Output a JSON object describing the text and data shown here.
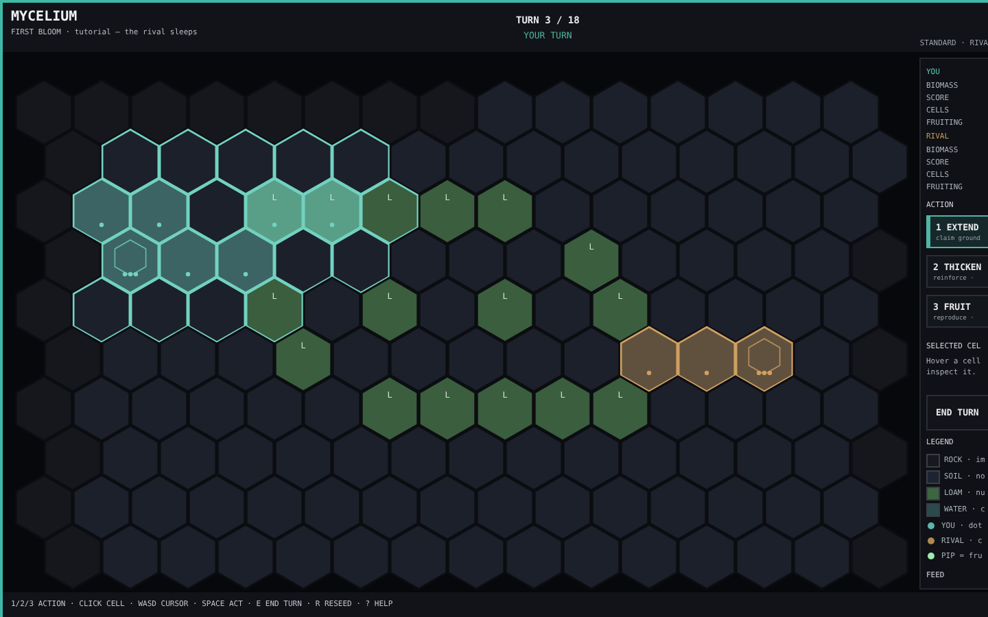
{
  "header": {
    "title": "MYCELIUM",
    "subtitle": "FIRST BLOOM · tutorial — the rival sleeps",
    "turn": "TURN 3 / 18",
    "turn_state": "YOUR TURN",
    "mode": "STANDARD · RIVA"
  },
  "map": {
    "rows": [
      {
        "cells": [
          {
            "kind": "rock"
          },
          {
            "kind": "rock"
          },
          {
            "kind": "rock"
          },
          {
            "kind": "rock"
          },
          {
            "kind": "rock"
          },
          {
            "kind": "rock"
          },
          {
            "kind": "rock"
          },
          {
            "kind": "rock"
          },
          {
            "kind": "soil"
          },
          {
            "kind": "soil"
          },
          {
            "kind": "soil"
          },
          {
            "kind": "soil"
          },
          {
            "kind": "soil"
          },
          {
            "kind": "soil"
          },
          {
            "kind": "soil"
          }
        ]
      },
      {
        "cells": [
          {
            "kind": "rock"
          },
          {
            "kind": "soil",
            "color": "#72d2c0",
            "biomass": false,
            "fruiting": false
          },
          {
            "kind": "soil",
            "color": "#72d2c0",
            "biomass": false,
            "fruiting": false
          },
          {
            "kind": "soil",
            "color": "#72d2c0",
            "biomass": false,
            "fruiting": false
          },
          {
            "kind": "soil",
            "color": "#72d2c0",
            "biomass": false,
            "fruiting": false
          },
          {
            "kind": "soil",
            "color": "#72d2c0",
            "biomass": false,
            "fruiting": false
          },
          {
            "kind": "soil"
          },
          {
            "kind": "soil"
          },
          {
            "kind": "soil"
          },
          {
            "kind": "soil"
          },
          {
            "kind": "soil"
          },
          {
            "kind": "soil"
          },
          {
            "kind": "soil"
          },
          {
            "kind": "soil"
          },
          {
            "kind": "soil"
          }
        ]
      },
      {
        "cells": [
          {
            "kind": "rock"
          },
          {
            "kind": "soil",
            "color": "#72d2c0",
            "biomass": true,
            "fruiting": false
          },
          {
            "kind": "soil",
            "color": "#72d2c0",
            "biomass": true,
            "fruiting": false
          },
          {
            "kind": "soil",
            "color": "#72d2c0",
            "biomass": false,
            "fruiting": false
          },
          {
            "kind": "loam",
            "label": "L",
            "color": "#72d2c0",
            "biomass": true,
            "fruiting": false
          },
          {
            "kind": "loam",
            "label": "L",
            "color": "#72d2c0",
            "biomass": true,
            "fruiting": false
          },
          {
            "kind": "loam",
            "label": "L",
            "color": "#72d2c0",
            "biomass": false,
            "fruiting": false
          },
          {
            "kind": "loam",
            "label": "L"
          },
          {
            "kind": "loam",
            "label": "L"
          },
          {
            "kind": "soil"
          },
          {
            "kind": "soil"
          },
          {
            "kind": "soil"
          },
          {
            "kind": "soil"
          },
          {
            "kind": "soil"
          },
          {
            "kind": "soil"
          }
        ]
      },
      {
        "cells": [
          {
            "kind": "rock"
          },
          {
            "kind": "soil",
            "color": "#72d2c0",
            "biomass": true,
            "fruiting": true
          },
          {
            "kind": "soil",
            "color": "#72d2c0",
            "biomass": true,
            "fruiting": false
          },
          {
            "kind": "soil",
            "color": "#72d2c0",
            "biomass": true,
            "fruiting": false
          },
          {
            "kind": "soil",
            "color": "#72d2c0",
            "biomass": false,
            "fruiting": false
          },
          {
            "kind": "soil",
            "color": "#72d2c0",
            "biomass": false,
            "fruiting": false
          },
          {
            "kind": "soil"
          },
          {
            "kind": "soil"
          },
          {
            "kind": "soil"
          },
          {
            "kind": "loam",
            "label": "L"
          },
          {
            "kind": "soil"
          },
          {
            "kind": "soil"
          },
          {
            "kind": "soil"
          },
          {
            "kind": "soil"
          },
          {
            "kind": "rock"
          }
        ]
      },
      {
        "cells": [
          {
            "kind": "rock"
          },
          {
            "kind": "soil",
            "color": "#72d2c0",
            "biomass": false,
            "fruiting": false
          },
          {
            "kind": "soil",
            "color": "#72d2c0",
            "biomass": false,
            "fruiting": false
          },
          {
            "kind": "soil",
            "color": "#72d2c0",
            "biomass": false,
            "fruiting": false
          },
          {
            "kind": "loam",
            "label": "L",
            "color": "#72d2c0",
            "biomass": false,
            "fruiting": false
          },
          {
            "kind": "soil"
          },
          {
            "kind": "loam",
            "label": "L"
          },
          {
            "kind": "soil"
          },
          {
            "kind": "loam",
            "label": "L"
          },
          {
            "kind": "soil"
          },
          {
            "kind": "loam",
            "label": "L"
          },
          {
            "kind": "soil"
          },
          {
            "kind": "soil"
          },
          {
            "kind": "soil"
          },
          {
            "kind": "soil"
          }
        ]
      },
      {
        "cells": [
          {
            "kind": "rock"
          },
          {
            "kind": "soil"
          },
          {
            "kind": "soil"
          },
          {
            "kind": "soil"
          },
          {
            "kind": "loam",
            "label": "L"
          },
          {
            "kind": "soil"
          },
          {
            "kind": "soil"
          },
          {
            "kind": "soil"
          },
          {
            "kind": "soil"
          },
          {
            "kind": "soil"
          },
          {
            "kind": "soil",
            "color": "#d0a060",
            "biomass": true,
            "fruiting": false
          },
          {
            "kind": "soil",
            "color": "#d0a060",
            "biomass": true,
            "fruiting": false
          },
          {
            "kind": "soil",
            "color": "#d0a060",
            "biomass": true,
            "fruiting": true
          },
          {
            "kind": "soil"
          },
          {
            "kind": "rock"
          }
        ]
      },
      {
        "cells": [
          {
            "kind": "rock"
          },
          {
            "kind": "soil"
          },
          {
            "kind": "soil"
          },
          {
            "kind": "soil"
          },
          {
            "kind": "soil"
          },
          {
            "kind": "soil"
          },
          {
            "kind": "loam",
            "label": "L"
          },
          {
            "kind": "loam",
            "label": "L"
          },
          {
            "kind": "loam",
            "label": "L"
          },
          {
            "kind": "loam",
            "label": "L"
          },
          {
            "kind": "loam",
            "label": "L"
          },
          {
            "kind": "soil"
          },
          {
            "kind": "soil"
          },
          {
            "kind": "soil"
          },
          {
            "kind": "soil"
          }
        ]
      },
      {
        "cells": [
          {
            "kind": "rock"
          },
          {
            "kind": "soil"
          },
          {
            "kind": "soil"
          },
          {
            "kind": "soil"
          },
          {
            "kind": "soil"
          },
          {
            "kind": "soil"
          },
          {
            "kind": "soil"
          },
          {
            "kind": "soil"
          },
          {
            "kind": "soil"
          },
          {
            "kind": "soil"
          },
          {
            "kind": "soil"
          },
          {
            "kind": "soil"
          },
          {
            "kind": "soil"
          },
          {
            "kind": "soil"
          },
          {
            "kind": "rock"
          }
        ]
      },
      {
        "cells": [
          {
            "kind": "rock"
          },
          {
            "kind": "soil"
          },
          {
            "kind": "soil"
          },
          {
            "kind": "soil"
          },
          {
            "kind": "soil"
          },
          {
            "kind": "soil"
          },
          {
            "kind": "soil"
          },
          {
            "kind": "soil"
          },
          {
            "kind": "soil"
          },
          {
            "kind": "soil"
          },
          {
            "kind": "soil"
          },
          {
            "kind": "soil"
          },
          {
            "kind": "soil"
          },
          {
            "kind": "soil"
          },
          {
            "kind": "soil"
          }
        ]
      },
      {
        "cells": [
          {
            "kind": "rock"
          },
          {
            "kind": "soil"
          },
          {
            "kind": "soil"
          },
          {
            "kind": "soil"
          },
          {
            "kind": "soil"
          },
          {
            "kind": "soil"
          },
          {
            "kind": "soil"
          },
          {
            "kind": "soil"
          },
          {
            "kind": "soil"
          },
          {
            "kind": "soil"
          },
          {
            "kind": "soil"
          },
          {
            "kind": "soil"
          },
          {
            "kind": "soil"
          },
          {
            "kind": "soil"
          },
          {
            "kind": "rock"
          }
        ]
      }
    ]
  },
  "sidebar": {
    "players": [
      {
        "name": "YOU",
        "color": "#5fc7b4",
        "stats": [
          "BIOMASS",
          "SCORE",
          "CELLS",
          "FRUITING"
        ]
      },
      {
        "name": "RIVAL",
        "color": "#c99a5a",
        "stats": [
          "BIOMASS",
          "SCORE",
          "CELLS",
          "FRUITING"
        ]
      }
    ],
    "action_heading": "ACTION",
    "actions": [
      {
        "title": "1 EXTEND",
        "hint": "claim ground",
        "selected": true
      },
      {
        "title": "2 THICKEN",
        "hint": "reinforce ·",
        "selected": false
      },
      {
        "title": "3 FRUIT",
        "hint": "reproduce ·",
        "selected": false
      }
    ],
    "selected_heading": "SELECTED CEL",
    "selected_text": "Hover a cell inspect it.",
    "end_turn": "END TURN",
    "legend_heading": "LEGEND",
    "legend": [
      {
        "kind": "swatch",
        "color": "#17191e",
        "label": "ROCK · im"
      },
      {
        "kind": "swatch",
        "color": "#1d2330",
        "label": "SOIL · no"
      },
      {
        "kind": "swatch",
        "color": "#3d6541",
        "label": "LOAM · nu"
      },
      {
        "kind": "swatch",
        "color": "#2b4a4c",
        "label": "WATER · c"
      },
      {
        "kind": "dot",
        "color": "#5fb5ad",
        "label": "YOU · dot"
      },
      {
        "kind": "dot",
        "color": "#b08850",
        "label": "RIVAL · c"
      },
      {
        "kind": "dot",
        "color": "#9fe8b0",
        "label": "PIP = fru"
      }
    ],
    "feed_heading": "FEED"
  },
  "footer": "1/2/3 ACTION · CLICK CELL · WASD CURSOR · SPACE ACT · E END TURN · R RESEED · ? HELP"
}
